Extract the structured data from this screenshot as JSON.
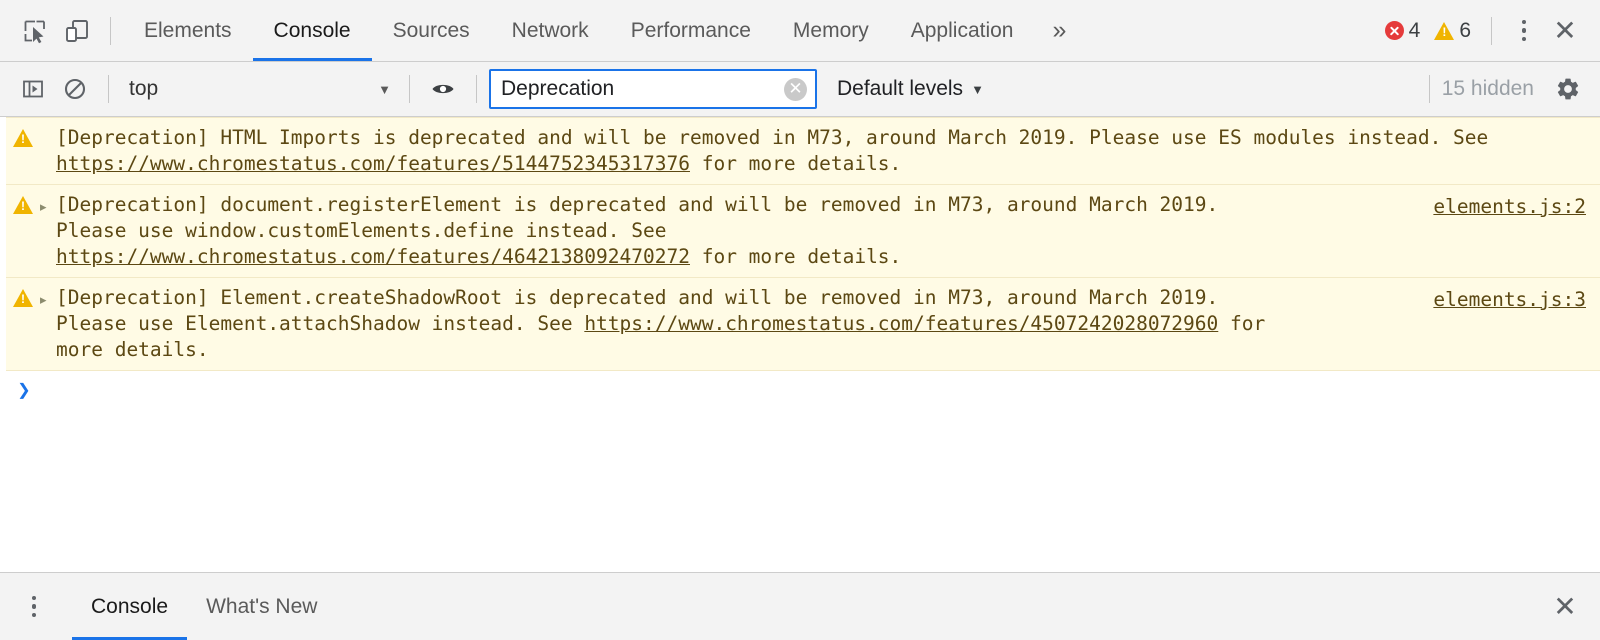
{
  "toolbar": {
    "icons": [
      {
        "name": "inspect-element-icon",
        "label": "Inspect element"
      },
      {
        "name": "device-toolbar-icon",
        "label": "Toggle device toolbar"
      }
    ],
    "tabs": [
      {
        "label": "Elements",
        "selected": false
      },
      {
        "label": "Console",
        "selected": true
      },
      {
        "label": "Sources",
        "selected": false
      },
      {
        "label": "Network",
        "selected": false
      },
      {
        "label": "Performance",
        "selected": false
      },
      {
        "label": "Memory",
        "selected": false
      },
      {
        "label": "Application",
        "selected": false
      }
    ],
    "more_tabs_label": "»",
    "error_count": "4",
    "warning_count": "6",
    "error_color": "#e53b3b",
    "warning_color": "#f0b400",
    "accent_color": "#1a73e8",
    "menu_label": "Customize and control DevTools",
    "close_label": "✕"
  },
  "filterbar": {
    "sidebar_toggle_label": "Show console sidebar",
    "clear_console_label": "Clear console",
    "context_value": "top",
    "context_caret": "▼",
    "live_expression_label": "Create live expression",
    "filter_value": "Deprecation",
    "filter_placeholder": "Filter",
    "filter_clear_label": "✕",
    "levels_label": "Default levels",
    "levels_caret": "▼",
    "hidden_count_label": "15 hidden",
    "settings_label": "Console settings"
  },
  "console": {
    "messages": [
      {
        "level": "warning",
        "expandable": false,
        "expand_glyph": "▸",
        "segments": [
          {
            "type": "text",
            "value": "[Deprecation] HTML Imports is deprecated and will be removed in M73, around March 2019. Please use ES modules instead. See "
          },
          {
            "type": "link",
            "value": "https://www.chromestatus.com/features/5144752345317376"
          },
          {
            "type": "text",
            "value": " for more details."
          }
        ],
        "source": ""
      },
      {
        "level": "warning",
        "expandable": true,
        "expand_glyph": "▸",
        "segments": [
          {
            "type": "text",
            "value": "[Deprecation] document.registerElement is deprecated and will be removed in M73, around March 2019. Please use window.customElements.define instead. See "
          },
          {
            "type": "link",
            "value": "https://www.chromestatus.com/features/4642138092470272"
          },
          {
            "type": "text",
            "value": " for more details."
          }
        ],
        "source": "elements.js:2"
      },
      {
        "level": "warning",
        "expandable": true,
        "expand_glyph": "▸",
        "segments": [
          {
            "type": "text",
            "value": "[Deprecation] Element.createShadowRoot is deprecated and will be removed in M73, around March 2019. Please use Element.attachShadow instead. See "
          },
          {
            "type": "link",
            "value": "https://www.chromestatus.com/features/4507242028072960"
          },
          {
            "type": "text",
            "value": " for more details."
          }
        ],
        "source": "elements.js:3"
      }
    ],
    "prompt_glyph": "❯",
    "prompt_value": "",
    "warning_bg": "#fffbe5",
    "warning_text_color": "#5c4813"
  },
  "drawer": {
    "menu_label": "More tools",
    "tabs": [
      {
        "label": "Console",
        "selected": true
      },
      {
        "label": "What's New",
        "selected": false
      }
    ],
    "close_label": "✕"
  }
}
